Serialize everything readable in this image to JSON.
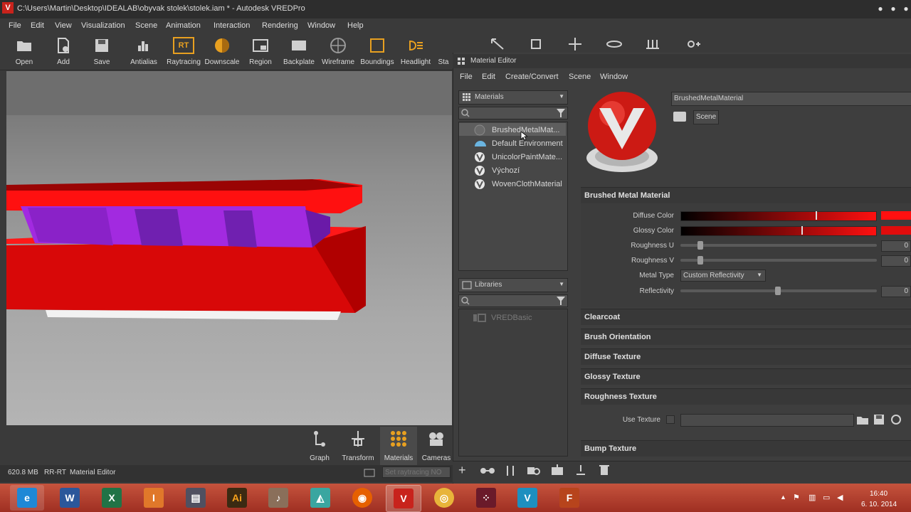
{
  "window": {
    "title": "C:\\Users\\Martin\\Desktop\\IDEALAB\\obyvak stolek\\stolek.iam * - Autodesk VREDPro",
    "app_icon": "V"
  },
  "menu": [
    "File",
    "Edit",
    "View",
    "Visualization",
    "Scene",
    "Animation",
    "Interaction",
    "Rendering",
    "Window",
    "Help"
  ],
  "toolbar": [
    {
      "label": "Open",
      "icon": "folder-icon"
    },
    {
      "label": "Add",
      "icon": "add-file-icon"
    },
    {
      "label": "Save",
      "icon": "floppy-icon"
    },
    {
      "label": "Antialias",
      "icon": "antialias-icon"
    },
    {
      "label": "Raytracing",
      "icon": "rt-icon",
      "text": "RT"
    },
    {
      "label": "Downscale",
      "icon": "downscale-icon"
    },
    {
      "label": "Region",
      "icon": "region-icon"
    },
    {
      "label": "Backplate",
      "icon": "backplate-icon"
    },
    {
      "label": "Wireframe",
      "icon": "wireframe-icon"
    },
    {
      "label": "Boundings",
      "icon": "boundings-icon"
    },
    {
      "label": "Headlight",
      "icon": "headlight-icon"
    },
    {
      "label": "Sta",
      "icon": "stats-icon"
    }
  ],
  "bottom_tools": [
    {
      "label": "Graph",
      "icon": "graph-icon"
    },
    {
      "label": "Transform",
      "icon": "transform-icon"
    },
    {
      "label": "Materials",
      "icon": "materials-icon"
    },
    {
      "label": "Cameras",
      "icon": "camera-icon"
    }
  ],
  "status": {
    "memory": "620.8 MB",
    "mode": "RR-RT",
    "panel": "Material Editor",
    "raytracing_placeholder": "Set raytracing NO"
  },
  "material_editor": {
    "title": "Material Editor",
    "menu": [
      "File",
      "Edit",
      "Create/Convert",
      "Scene",
      "Window"
    ],
    "materials_dropdown": "Materials",
    "materials": [
      {
        "name": "BrushedMetalMat...",
        "icon": "sphere-icon"
      },
      {
        "name": "Default Environment",
        "icon": "environment-icon"
      },
      {
        "name": "UnicolorPaintMate...",
        "icon": "vred-material-icon"
      },
      {
        "name": "Výchozí",
        "icon": "vred-material-icon"
      },
      {
        "name": "WovenClothMaterial",
        "icon": "vred-material-icon"
      }
    ],
    "libraries_dropdown": "Libraries",
    "libraries": [
      {
        "name": "VREDBasic"
      }
    ],
    "material_name": "BrushedMetalMaterial",
    "scene_button": "Scene",
    "sections": {
      "main": "Brushed Metal Material",
      "clearcoat": "Clearcoat",
      "brush_orientation": "Brush Orientation",
      "diffuse_texture": "Diffuse Texture",
      "glossy_texture": "Glossy Texture",
      "roughness_texture": "Roughness Texture",
      "bump_texture": "Bump Texture"
    },
    "properties": {
      "diffuse_color_label": "Diffuse Color",
      "glossy_color_label": "Glossy Color",
      "roughness_u_label": "Roughness U",
      "roughness_u_value": "0",
      "roughness_v_label": "Roughness V",
      "roughness_v_value": "0",
      "metal_type_label": "Metal Type",
      "metal_type_value": "Custom Reflectivity",
      "reflectivity_label": "Reflectivity",
      "reflectivity_value": "0",
      "use_texture_label": "Use Texture"
    }
  },
  "taskbar": {
    "apps": [
      {
        "name": "internet-explorer",
        "text": "e",
        "color": "#1e88d6"
      },
      {
        "name": "word",
        "text": "W",
        "color": "#2b579a"
      },
      {
        "name": "excel",
        "text": "X",
        "color": "#217346"
      },
      {
        "name": "inventor",
        "text": "I",
        "color": "#e0782a"
      },
      {
        "name": "video-editor",
        "text": "▤",
        "color": "#505060"
      },
      {
        "name": "illustrator",
        "text": "Ai",
        "color": "#3b2a12"
      },
      {
        "name": "audition",
        "text": "♪",
        "color": "#8a6f5a"
      },
      {
        "name": "showcase",
        "text": "◭",
        "color": "#3aa6a0"
      },
      {
        "name": "firefox",
        "text": "◉",
        "color": "#e66000"
      },
      {
        "name": "vred",
        "text": "V",
        "color": "#c8231c"
      },
      {
        "name": "chrome",
        "text": "◎",
        "color": "#e8b43a"
      },
      {
        "name": "app-dots",
        "text": "⁘",
        "color": "#6a1a2a"
      },
      {
        "name": "vred-tool",
        "text": "V",
        "color": "#1d8fbf"
      },
      {
        "name": "flash",
        "text": "F",
        "color": "#b7441c"
      }
    ],
    "time": "16:40",
    "date": "6. 10. 2014"
  },
  "colors": {
    "accent": "#c8231c",
    "ui_dark": "#3a3a3a",
    "model_red": "#ff1010",
    "model_purple": "#9a2ad8"
  }
}
